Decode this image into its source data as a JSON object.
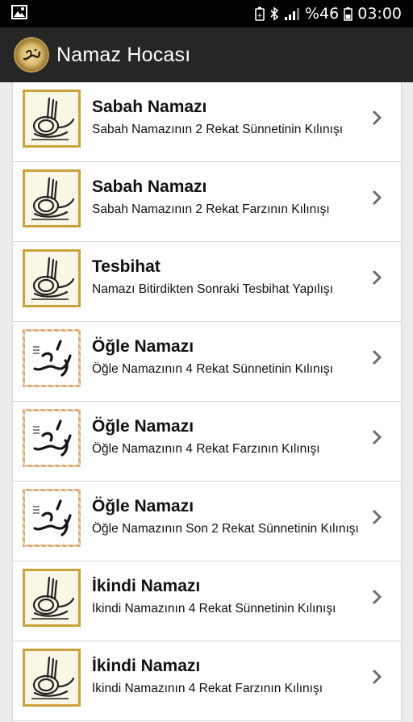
{
  "status_bar": {
    "battery_text": "%46",
    "time": "03:00",
    "icons": [
      "image-icon",
      "battery-saver-icon",
      "bluetooth-icon",
      "signal-icon",
      "battery-icon"
    ]
  },
  "app_bar": {
    "title": "Namaz Hocası",
    "logo": "muhammad-calligraphy-logo"
  },
  "items": [
    {
      "title": "Sabah Namazı",
      "subtitle": "Sabah Namazının 2 Rekat Sünnetinin Kılınışı",
      "thumbnail": "tughra-icon"
    },
    {
      "title": "Sabah Namazı",
      "subtitle": "Sabah Namazının 2 Rekat Farzının Kılınışı",
      "thumbnail": "tughra-icon"
    },
    {
      "title": "Tesbihat",
      "subtitle": "Namazı Bitirdikten Sonraki Tesbihat Yapılışı",
      "thumbnail": "tughra-icon"
    },
    {
      "title": "Öğle Namazı",
      "subtitle": "Öğle Namazının 4 Rekat Sünnetinin Kılınışı",
      "thumbnail": "muhammad-calligraphy-icon"
    },
    {
      "title": "Öğle Namazı",
      "subtitle": "Öğle Namazının 4 Rekat Farzının Kılınışı",
      "thumbnail": "muhammad-calligraphy-icon"
    },
    {
      "title": "Öğle Namazı",
      "subtitle": "Öğle Namazının Son 2 Rekat Sünnetinin Kılınışı",
      "thumbnail": "muhammad-calligraphy-icon"
    },
    {
      "title": "İkindi Namazı",
      "subtitle": "İkindi Namazının 4 Rekat Sünnetinin Kılınışı",
      "thumbnail": "tughra-icon"
    },
    {
      "title": "İkindi Namazı",
      "subtitle": "İkindi Namazının 4 Rekat Farzının Kılınışı",
      "thumbnail": "tughra-icon"
    }
  ],
  "colors": {
    "status_bar_bg": "#000000",
    "app_bar_bg": "#262626",
    "list_bg": "#ffffff",
    "page_bg": "#ececec",
    "divider": "#d6d6d6",
    "chevron": "#6e6e6e",
    "tughra_frame": "#c9a23a"
  }
}
